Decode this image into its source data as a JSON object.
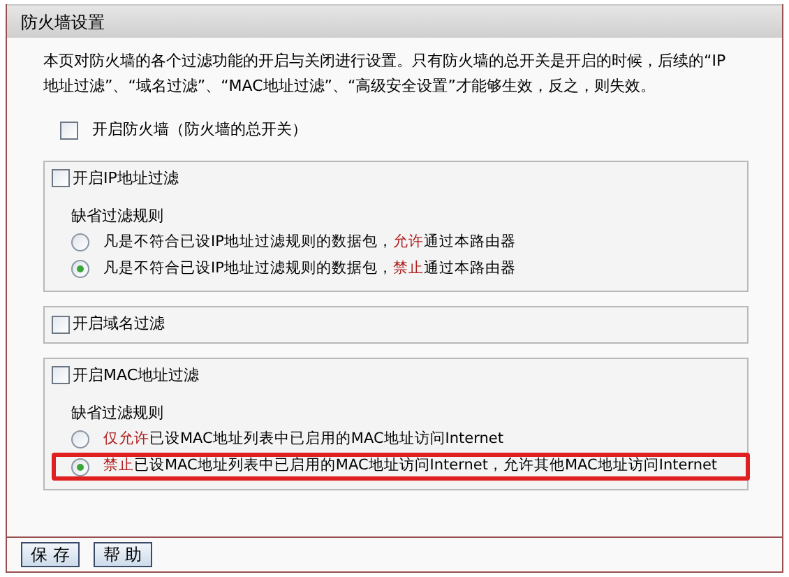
{
  "panel": {
    "title": "防火墙设置"
  },
  "description": "本页对防火墙的各个过滤功能的开启与关闭进行设置。只有防火墙的总开关是开启的时候，后续的“IP地址过滤”、“域名过滤”、“MAC地址过滤”、“高级安全设置”才能够生效，反之，则失效。",
  "master_switch": {
    "label": "开启防火墙（防火墙的总开关）",
    "checked": false
  },
  "sections": [
    {
      "label": "开启IP地址过滤",
      "checked": false,
      "rules_title": "缺省过滤规则",
      "options": [
        {
          "before": "凡是不符合已设IP地址过滤规则的数据包，",
          "keyword": "允许",
          "after": "通过本路由器",
          "selected": false,
          "highlighted": false
        },
        {
          "before": "凡是不符合已设IP地址过滤规则的数据包，",
          "keyword": "禁止",
          "after": "通过本路由器",
          "selected": true,
          "highlighted": false
        }
      ]
    },
    {
      "label": "开启域名过滤",
      "checked": false
    },
    {
      "label": "开启MAC地址过滤",
      "checked": false,
      "rules_title": "缺省过滤规则",
      "options": [
        {
          "keyword": "仅允许",
          "after": "已设MAC地址列表中已启用的MAC地址访问Internet",
          "selected": false,
          "highlighted": false
        },
        {
          "keyword": "禁止",
          "after": "已设MAC地址列表中已启用的MAC地址访问Internet，允许其他MAC地址访问Internet",
          "selected": true,
          "highlighted": true
        }
      ]
    }
  ],
  "buttons": [
    "保 存",
    "帮 助"
  ]
}
